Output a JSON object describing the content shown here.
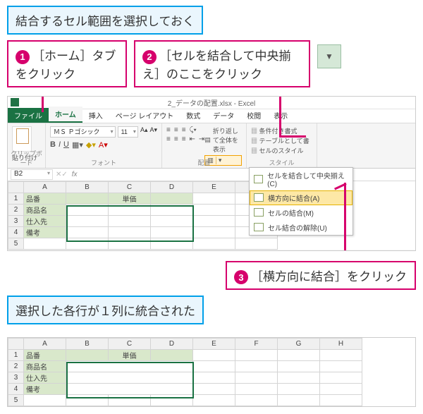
{
  "callouts": {
    "top_blue": "結合するセル範囲を選択しておく",
    "c1_num": "1",
    "c1_text": "［ホーム］タブをクリック",
    "c2_num": "2",
    "c2_text": "［セルを結合して中央揃え］のここをクリック",
    "c3_num": "3",
    "c3_text": "［横方向に結合］をクリック",
    "bottom_blue": "選択した各行が１列に統合された"
  },
  "dropdown_glyph": "▼",
  "excel": {
    "title": "2_データの配置.xlsx - Excel",
    "tabs": {
      "file": "ファイル",
      "home": "ホーム",
      "insert": "挿入",
      "layout": "ページ レイアウト",
      "formulas": "数式",
      "data": "データ",
      "review": "校閲",
      "view": "表示"
    },
    "groups": {
      "clipboard": "クリップボード",
      "paste": "貼り付け",
      "font_label": "フォント",
      "align_label": "配置",
      "style_label": "スタイル"
    },
    "font": {
      "name": "ＭＳ Ｐゴシック",
      "size": "11",
      "bold": "B",
      "italic": "I",
      "underline": "U",
      "increase": "A▴",
      "decrease": "A▾"
    },
    "wrap_text": "折り返して全体を表示",
    "merge_btn": "セルを結合して中央揃え",
    "styles": {
      "cond": "条件付き書式",
      "table": "テーブルとして書",
      "cell": "セルのスタイル"
    },
    "merge_menu": {
      "m1": "セルを結合して中央揃え(C)",
      "m2": "横方向に結合(A)",
      "m3": "セルの結合(M)",
      "m4": "セル結合の解除(U)"
    },
    "namebox": "B2",
    "cols": [
      "A",
      "B",
      "C",
      "D",
      "E",
      "F",
      "G",
      "H"
    ],
    "rows1": {
      "r1a": "品番",
      "r1c": "単価",
      "r2a": "商品名",
      "r3a": "仕入先",
      "r4a": "備考"
    }
  }
}
